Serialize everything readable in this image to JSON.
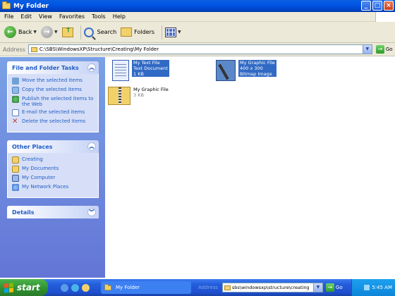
{
  "window": {
    "title": "My Folder"
  },
  "menu": [
    "File",
    "Edit",
    "View",
    "Favorites",
    "Tools",
    "Help"
  ],
  "toolbar": {
    "back": "Back",
    "search": "Search",
    "folders": "Folders"
  },
  "address": {
    "label": "Address",
    "value": "C:\\SBS\\WindowsXP\\Structure\\Creating\\My Folder",
    "go": "Go"
  },
  "file_tasks": {
    "title": "File and Folder Tasks",
    "items": [
      "Move the selected items",
      "Copy the selected items",
      "Publish the selected items to the Web",
      "E-mail the selected items",
      "Delete the selected items"
    ]
  },
  "other_places": {
    "title": "Other Places",
    "items": [
      "Creating",
      "My Documents",
      "My Computer",
      "My Network Places"
    ]
  },
  "details": {
    "title": "Details"
  },
  "files": [
    {
      "name": "My Text File",
      "type": "Text Document",
      "size": "1 KB"
    },
    {
      "name": "My Graphic File",
      "type": "400 x 300",
      "size": "Bitmap Image"
    },
    {
      "name": "My Graphic File",
      "type": "3 KB",
      "size": ""
    }
  ],
  "taskbar": {
    "start": "start",
    "task": "My Folder",
    "address_label": "Address",
    "address_value": "sbs\\windowsxp\\structure\\creating",
    "go": "Go",
    "clock": "5:45 AM"
  }
}
